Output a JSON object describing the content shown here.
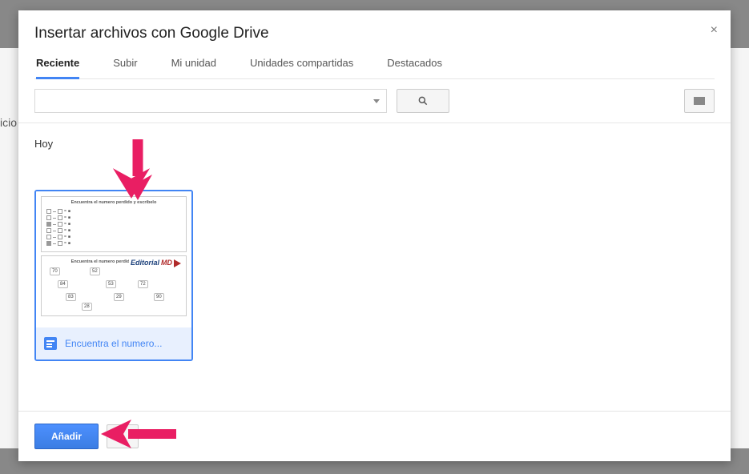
{
  "dialog": {
    "title": "Insertar archivos con Google Drive"
  },
  "tabs": {
    "items": [
      {
        "label": "Reciente",
        "active": true
      },
      {
        "label": "Subir",
        "active": false
      },
      {
        "label": "Mi unidad",
        "active": false
      },
      {
        "label": "Unidades compartidas",
        "active": false
      },
      {
        "label": "Destacados",
        "active": false
      }
    ]
  },
  "search": {
    "value": ""
  },
  "content": {
    "section_label": "Hoy",
    "files": [
      {
        "name": "Encuentra el numero...",
        "thumb_title": "Encuentra el numero perdido y escribelo",
        "watermark": "Editorial",
        "selected": true,
        "type": "google-doc"
      }
    ]
  },
  "footer": {
    "primary": "Añadir"
  },
  "background": {
    "fragment1": "icio"
  }
}
